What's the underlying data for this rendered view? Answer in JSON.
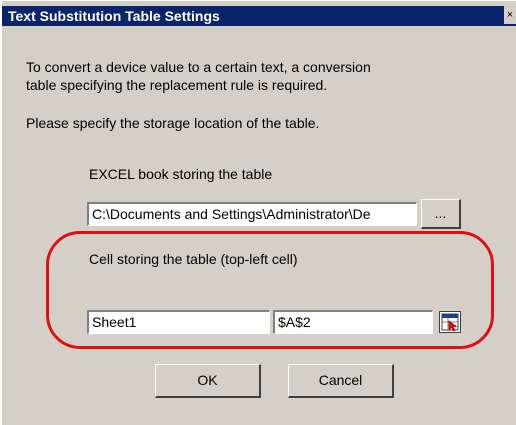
{
  "window": {
    "title": "Text Substitution Table Settings",
    "close_glyph": "×"
  },
  "intro": {
    "line1": "To convert a device value to a certain text, a conversion",
    "line2": "table specifying the replacement rule is required.",
    "line3": "Please specify the storage location of the table."
  },
  "excel_book": {
    "label": "EXCEL book storing the table",
    "value": "C:\\Documents and Settings\\Administrator\\De",
    "browse_label": "..."
  },
  "cell": {
    "label": "Cell storing the table (top-left cell)",
    "sheet_value": "Sheet1",
    "cell_value": "$A$2",
    "picker_icon": "cell-picker-icon"
  },
  "buttons": {
    "ok": "OK",
    "cancel": "Cancel"
  },
  "colors": {
    "title_bar": "#0a246a",
    "dialog_bg": "#d4d0c8",
    "highlight": "#e01010"
  }
}
